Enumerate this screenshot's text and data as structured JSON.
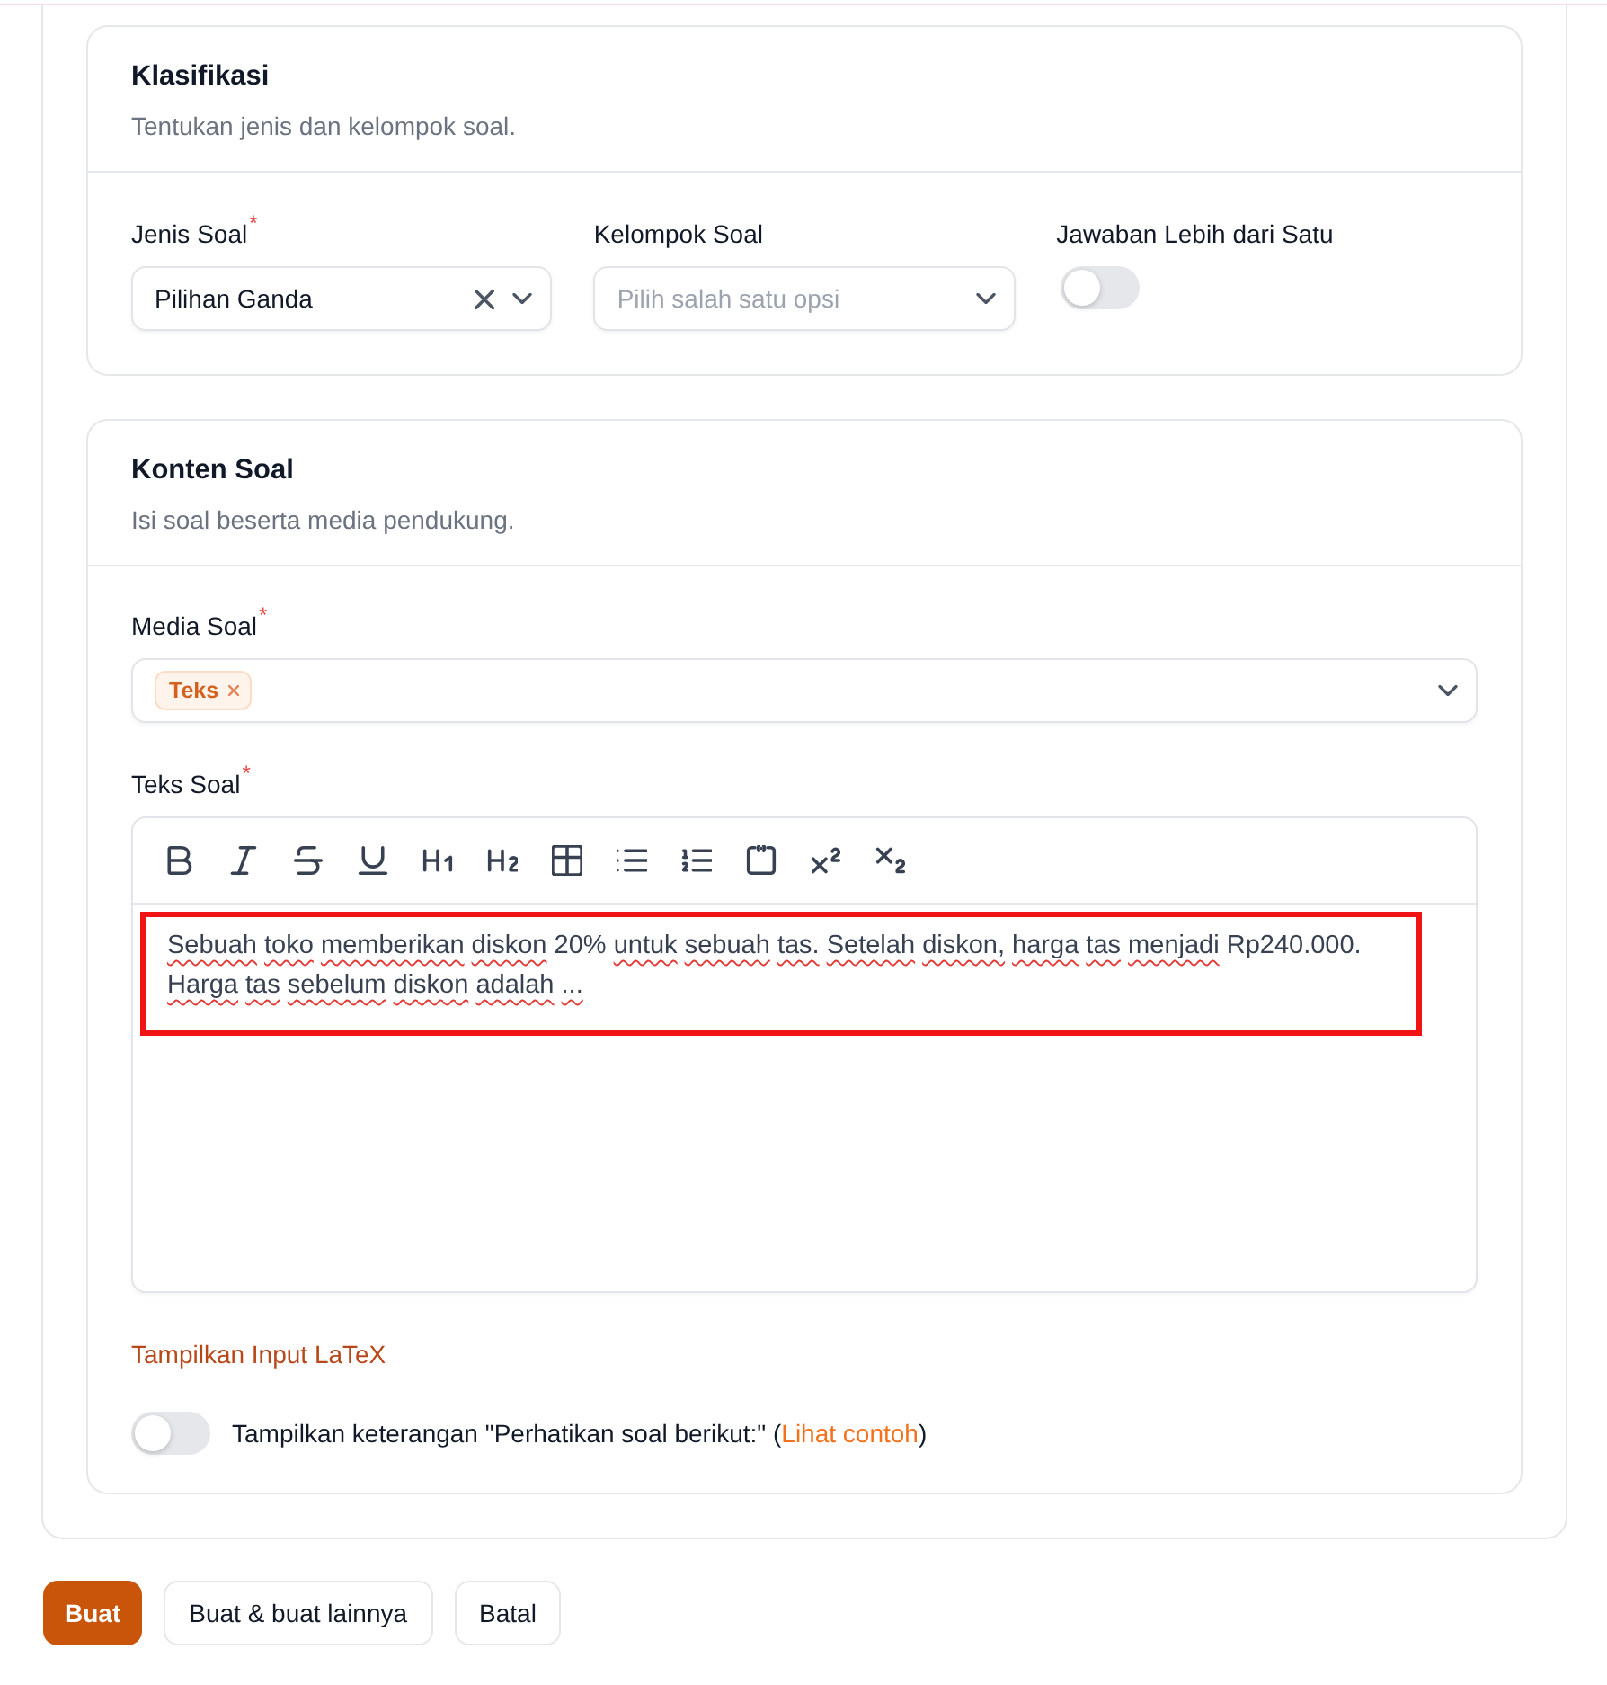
{
  "classification": {
    "title": "Klasifikasi",
    "description": "Tentukan jenis dan kelompok soal.",
    "fields": [
      {
        "kind": "select",
        "label": "Jenis Soal",
        "required_mark": "*",
        "value": "Pilihan Ganda",
        "clearable": true
      },
      {
        "kind": "select",
        "label": "Kelompok Soal",
        "placeholder": "Pilih salah satu opsi"
      },
      {
        "kind": "toggle",
        "label": "Jawaban Lebih dari Satu",
        "on": false
      }
    ]
  },
  "content": {
    "title": "Konten Soal",
    "description": "Isi soal beserta media pendukung.",
    "media": {
      "label": "Media Soal",
      "required_mark": "*",
      "tags": [
        {
          "label": "Teks"
        }
      ]
    },
    "question": {
      "label": "Teks Soal",
      "required_mark": "*",
      "highlighted": true,
      "lines": [
        [
          {
            "text": "Sebuah",
            "misspelled": true
          },
          {
            "text": "toko",
            "misspelled": true
          },
          {
            "text": "memberikan",
            "misspelled": true
          },
          {
            "text": "diskon",
            "misspelled": true
          },
          {
            "text": "20%",
            "misspelled": false
          },
          {
            "text": "untuk",
            "misspelled": true
          },
          {
            "text": "sebuah",
            "misspelled": true
          },
          {
            "text": "tas.",
            "misspelled": true
          },
          {
            "text": "Setelah",
            "misspelled": true
          },
          {
            "text": "diskon,",
            "misspelled": true
          },
          {
            "text": "harga",
            "misspelled": true
          },
          {
            "text": "tas",
            "misspelled": true
          },
          {
            "text": "menjadi",
            "misspelled": true
          },
          {
            "text": "Rp240.000.",
            "misspelled": false
          }
        ],
        [
          {
            "text": "Harga",
            "misspelled": true
          },
          {
            "text": "tas",
            "misspelled": true
          },
          {
            "text": "sebelum",
            "misspelled": true
          },
          {
            "text": "diskon",
            "misspelled": true
          },
          {
            "text": "adalah",
            "misspelled": true
          },
          {
            "text": "...",
            "misspelled": true
          }
        ]
      ]
    },
    "latex_link": "Tampilkan Input LaTeX",
    "hint_toggle": {
      "on": false,
      "label": "Tampilkan keterangan \"Perhatikan soal berikut:\" (",
      "link": "Lihat contoh",
      "label_end": ")"
    }
  },
  "actions": [
    {
      "label": "Buat",
      "kind": "primary"
    },
    {
      "label": "Buat & buat lainnya",
      "kind": "secondary"
    },
    {
      "label": "Batal",
      "kind": "secondary"
    }
  ]
}
